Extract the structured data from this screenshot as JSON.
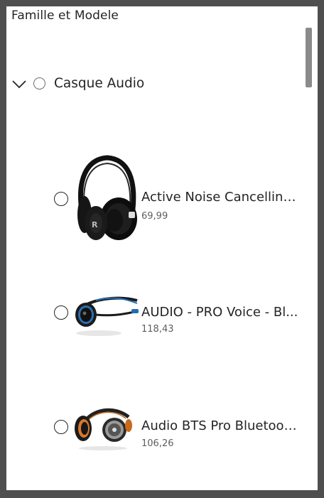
{
  "panel": {
    "title": "Famille et Modele"
  },
  "group": {
    "label": "Casque Audio",
    "expanded": true
  },
  "items": [
    {
      "name": "Active Noise Cancelling...",
      "price": "69,99",
      "icon": "over-ear-headphones-icon"
    },
    {
      "name": "AUDIO - PRO Voice - Bl...",
      "price": "118,43",
      "icon": "neckband-headset-icon"
    },
    {
      "name": "Audio BTS Pro Bluetoot...",
      "price": "106,26",
      "icon": "behind-neck-headphones-icon"
    }
  ],
  "colors": {
    "frame": "#4f4f4f",
    "text": "#252423",
    "secondary_text": "#605e5c",
    "scrollbar": "#8a8a8a"
  }
}
